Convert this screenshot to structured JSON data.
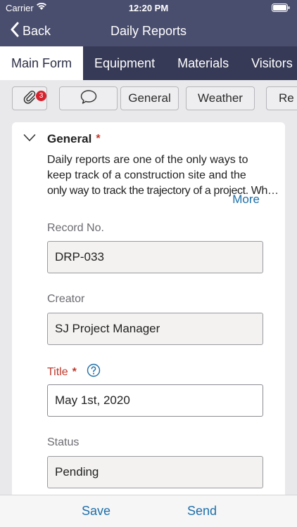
{
  "status_bar": {
    "carrier": "Carrier",
    "time": "12:20 PM"
  },
  "nav": {
    "back_label": "Back",
    "title": "Daily Reports"
  },
  "tabs": [
    {
      "label": "Main Form",
      "active": true
    },
    {
      "label": "Equipment",
      "active": false
    },
    {
      "label": "Materials",
      "active": false
    },
    {
      "label": "Visitors",
      "active": false
    }
  ],
  "chips": {
    "attachments_icon": "paperclip-icon",
    "attachments_count": "3",
    "comments_icon": "speech-bubble-icon",
    "general_label": "General",
    "weather_label": "Weather",
    "partial_label": "Re"
  },
  "section": {
    "title": "General",
    "required_mark": "*",
    "description_line1": "Daily reports are one of the only ways to",
    "description_line2": "keep track of a construction site and the",
    "description_line3": "only way to track the trajectory of a project. Wh…",
    "more_label": "More"
  },
  "fields": {
    "record_no": {
      "label": "Record No.",
      "value": "DRP-033"
    },
    "creator": {
      "label": "Creator",
      "value": "SJ Project Manager"
    },
    "title": {
      "label": "Title",
      "required_mark": "*",
      "value": "May 1st, 2020"
    },
    "status": {
      "label": "Status",
      "value": "Pending"
    }
  },
  "bottom": {
    "save_label": "Save",
    "send_label": "Send"
  },
  "colors": {
    "nav_bg": "#4a4e6e",
    "tab_bg": "#373a57",
    "accent_blue": "#1e6fa8",
    "required_red": "#c0392b",
    "badge_red": "#d5222d"
  }
}
